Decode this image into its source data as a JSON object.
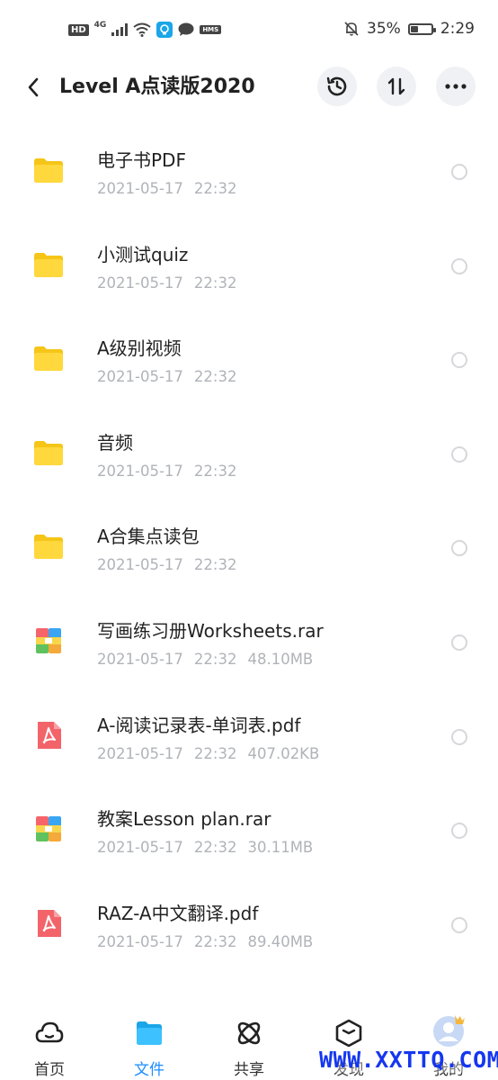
{
  "status_bar": {
    "left_badges": [
      "HD",
      "4G",
      "HMS"
    ],
    "battery": "35%",
    "battery_level": 0.35,
    "time": "2:29"
  },
  "header": {
    "title": "Level A点读版2020",
    "buttons": [
      "back-arrow-icon",
      "history-icon",
      "sort-icon",
      "more-icon"
    ]
  },
  "files": [
    {
      "name": "电子书PDF",
      "date": "2021-05-17",
      "time": "22:32",
      "size": "",
      "type": "folder"
    },
    {
      "name": "小测试quiz",
      "date": "2021-05-17",
      "time": "22:32",
      "size": "",
      "type": "folder"
    },
    {
      "name": "A级别视频",
      "date": "2021-05-17",
      "time": "22:32",
      "size": "",
      "type": "folder"
    },
    {
      "name": "音频",
      "date": "2021-05-17",
      "time": "22:32",
      "size": "",
      "type": "folder"
    },
    {
      "name": "A合集点读包",
      "date": "2021-05-17",
      "time": "22:32",
      "size": "",
      "type": "folder"
    },
    {
      "name": "写画练习册Worksheets.rar",
      "date": "2021-05-17",
      "time": "22:32",
      "size": "48.10MB",
      "type": "rar"
    },
    {
      "name": "A-阅读记录表-单词表.pdf",
      "date": "2021-05-17",
      "time": "22:32",
      "size": "407.02KB",
      "type": "pdf"
    },
    {
      "name": "教案Lesson plan.rar",
      "date": "2021-05-17",
      "time": "22:32",
      "size": "30.11MB",
      "type": "rar"
    },
    {
      "name": "RAZ-A中文翻译.pdf",
      "date": "2021-05-17",
      "time": "22:32",
      "size": "89.40MB",
      "type": "pdf"
    }
  ],
  "nav": {
    "items": [
      {
        "label": "首页",
        "icon": "cloud-icon"
      },
      {
        "label": "文件",
        "icon": "folder-icon",
        "active": true
      },
      {
        "label": "共享",
        "icon": "atom-icon"
      },
      {
        "label": "发现",
        "icon": "box-icon"
      },
      {
        "label": "我的",
        "icon": "avatar-icon"
      }
    ]
  },
  "watermark": "WWW.XXTTQ.COM",
  "colors": {
    "folder": "#ffd83d",
    "accent": "#1a8cff",
    "pdf": "#f2646a",
    "meta_text": "#b0b3b8"
  }
}
